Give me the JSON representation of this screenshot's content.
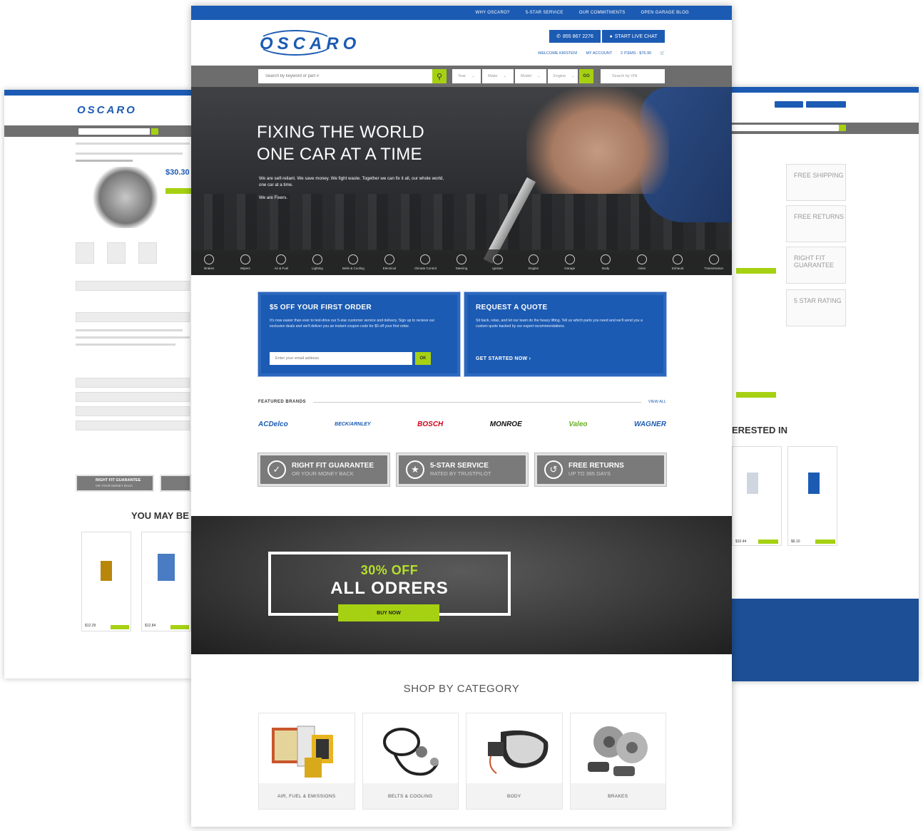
{
  "utility_nav": [
    "WHY OSCARO?",
    "5-STAR SERVICE",
    "OUR COMMITMENTS",
    "OPEN GARAGE BLOG"
  ],
  "logo": "OSCARO",
  "header": {
    "phone": "855 867 2276",
    "chat": "START LIVE CHAT",
    "welcome": "WELCOME KIRSTEN!",
    "account": "MY ACCOUNT",
    "cart": "2 ITEMS - $76.90"
  },
  "search": {
    "placeholder": "Search by keyword or part #",
    "year": "Year",
    "make": "Make",
    "model": "Model",
    "engine": "Engine",
    "go": "GO",
    "vin": "Search by VIN"
  },
  "hero": {
    "title_line1": "FIXING THE WORLD",
    "title_line2": "ONE CAR AT A TIME",
    "text": "We are self-reliant. We save money. We fight waste. Together we can fix it all, our whole world, one car at a time.",
    "text2": "We are Fixers."
  },
  "categories_strip": [
    "Brakes",
    "Wipers",
    "Air & Fuel",
    "Lighting",
    "Belts & Cooling",
    "Electrical",
    "Climate Control",
    "Steering",
    "Ignition",
    "Engine",
    "Garage",
    "Body",
    "Axles",
    "Exhaust",
    "Transmission"
  ],
  "promo_first_order": {
    "title": "$5 OFF YOUR FIRST ORDER",
    "text": "It's now easier than ever to test-drive our 5-star customer service and delivery. Sign up to recieve our exclusive deals and we'll deliver you an instant coupon code for $5 off your first order.",
    "email_placeholder": "Enter your email address",
    "ok": "OK"
  },
  "promo_quote": {
    "title": "REQUEST A QUOTE",
    "text": "Sit back, relax, and let our team do the heavy lifting. Tell us which parts you need and we'll send you a custom quote backed by our expert recommendations.",
    "cta": "GET STARTED NOW ›"
  },
  "featured": {
    "label": "FEATURED BRANDS",
    "view_all": "VIEW ALL",
    "brands": [
      "ACDelco",
      "BECK/ARNLEY",
      "BOSCH",
      "MONROE",
      "Valeo",
      "WAGNER"
    ]
  },
  "guarantees": [
    {
      "title": "RIGHT FIT GUARANTEE",
      "sub": "OR YOUR MONEY BACK"
    },
    {
      "title": "5-STAR SERVICE",
      "sub": "RATED BY TRUSTPILOT"
    },
    {
      "title": "FREE RETURNS",
      "sub": "UP TO 365 DAYS"
    }
  ],
  "offer": {
    "headline": "30% OFF",
    "sub": "ALL ODRERS",
    "button": "BUY NOW"
  },
  "shop": {
    "title": "SHOP BY CATEGORY",
    "cards": [
      "AIR, FUEL & EMISSIONS",
      "BELTS & COOLING",
      "BODY",
      "BRAKES"
    ]
  },
  "left_page": {
    "price": "$30.30",
    "you_may": "YOU MAY BE",
    "guarantee": "RIGHT FIT GUARANTEE",
    "guarantee_sub": "OR YOUR MONEY BACK",
    "price_a": "$12.29",
    "price_b": "$12.84"
  },
  "right_page": {
    "features": [
      "FREE SHIPPING",
      "FREE RETURNS",
      "RIGHT FIT GUARANTEE",
      "5 STAR RATING"
    ],
    "interested": "ERESTED IN",
    "price_a": "$10.44",
    "price_b": "$6.10"
  },
  "colors": {
    "brand_blue": "#1c5bb3",
    "accent_lime": "#a6d112",
    "dark_band": "#3a3a3a"
  }
}
